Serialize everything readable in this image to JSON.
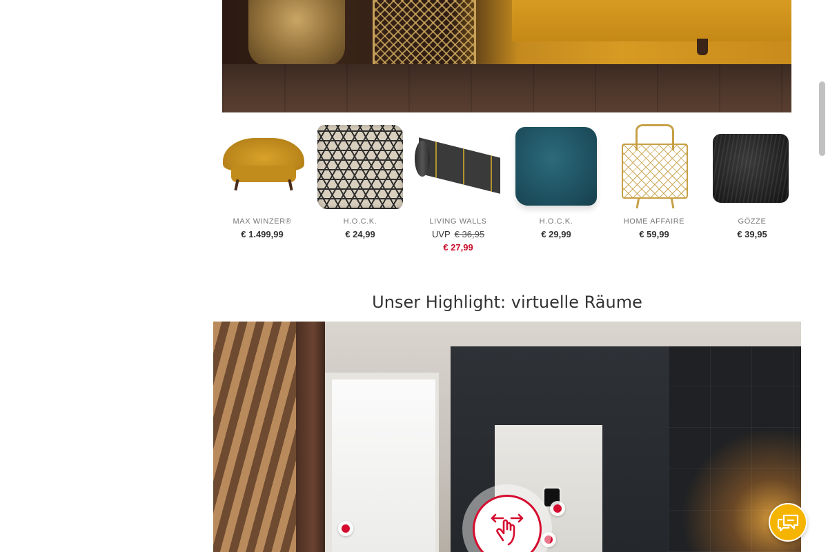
{
  "hero": {
    "alt": "Wohnzimmer mit Sofa, Beistelltisch und Zeitungsständer"
  },
  "products": [
    {
      "brand": "MAX WINZER®",
      "price": "€ 1.499,99",
      "image": "sofa"
    },
    {
      "brand": "H.O.C.K.",
      "price": "€ 24,99",
      "image": "geometric-pillow"
    },
    {
      "brand": "LIVING WALLS",
      "uvp_label": "UVP",
      "old_price": "€ 36,95",
      "sale_price": "€ 27,99",
      "image": "wallpaper-roll"
    },
    {
      "brand": "H.O.C.K.",
      "price": "€ 29,99",
      "image": "teal-pillow"
    },
    {
      "brand": "HOME AFFAIRE",
      "price": "€ 59,99",
      "image": "magazine-rack"
    },
    {
      "brand": "GÖZZE",
      "price": "€ 39,95",
      "image": "fur-pillow"
    }
  ],
  "highlight": {
    "title": "Unser Highlight: virtuelle Räume"
  },
  "room": {
    "hotspots": [
      {
        "name": "hotspot-window-plant"
      },
      {
        "name": "hotspot-lamp"
      },
      {
        "name": "hotspot-door"
      }
    ],
    "swipe_icon": "swipe-hand-icon"
  },
  "chat": {
    "icon": "chat-bubbles-icon"
  },
  "colors": {
    "accent_red": "#d50c2f",
    "sale_red": "#c8102e",
    "chat_yellow": "#f5b400",
    "text": "#333333",
    "brand_grey": "#777777"
  }
}
